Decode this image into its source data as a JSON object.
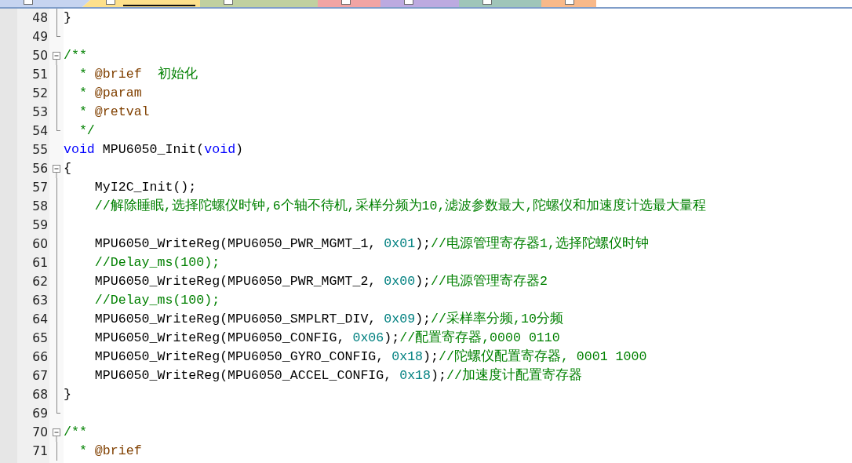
{
  "tabs": [
    {
      "color": "#c6d4f0",
      "selected": false
    },
    {
      "color": "#fde08c",
      "selected": true
    },
    {
      "color": "#c0d0a0",
      "selected": false
    },
    {
      "color": "#f0a4a4",
      "selected": false
    },
    {
      "color": "#bcaae0",
      "selected": false
    },
    {
      "color": "#9fc5b9",
      "selected": false
    },
    {
      "color": "#f8b98a",
      "selected": false
    }
  ],
  "lines": [
    {
      "number": "48",
      "kind": "body",
      "tokens": [
        {
          "kind": "plain",
          "text": "}"
        }
      ]
    },
    {
      "number": "49",
      "kind": "end"
    },
    {
      "number": "50",
      "kind": "start",
      "tokens": [
        {
          "kind": "comment",
          "text": "/**"
        }
      ]
    },
    {
      "number": "51",
      "kind": "body",
      "tokens": [
        {
          "kind": "comment",
          "text": "  * "
        },
        {
          "kind": "doctag",
          "text": "@brief"
        },
        {
          "kind": "comment",
          "text": "  初始化"
        }
      ]
    },
    {
      "number": "52",
      "kind": "body",
      "tokens": [
        {
          "kind": "comment",
          "text": "  * "
        },
        {
          "kind": "doctag",
          "text": "@param"
        }
      ]
    },
    {
      "number": "53",
      "kind": "body",
      "tokens": [
        {
          "kind": "comment",
          "text": "  * "
        },
        {
          "kind": "doctag",
          "text": "@retval"
        }
      ]
    },
    {
      "number": "54",
      "kind": "end",
      "tokens": [
        {
          "kind": "comment",
          "text": "  */"
        }
      ]
    },
    {
      "number": "55",
      "kind": "plain",
      "tokens": [
        {
          "kind": "keyword",
          "text": "void"
        },
        {
          "kind": "plain",
          "text": " MPU6050_Init("
        },
        {
          "kind": "keyword",
          "text": "void"
        },
        {
          "kind": "plain",
          "text": ")"
        }
      ]
    },
    {
      "number": "56",
      "kind": "start",
      "tokens": [
        {
          "kind": "plain",
          "text": "{"
        }
      ]
    },
    {
      "number": "57",
      "kind": "body",
      "tokens": [
        {
          "kind": "plain",
          "text": "    MyI2C_Init();"
        }
      ]
    },
    {
      "number": "58",
      "kind": "body",
      "tokens": [
        {
          "kind": "comment",
          "text": "    //解除睡眠,选择陀螺仪时钟,6个轴不待机,采样分频为10,滤波参数最大,陀螺仪和加速度计选最大量程"
        }
      ]
    },
    {
      "number": "59",
      "kind": "body"
    },
    {
      "number": "60",
      "kind": "body",
      "tokens": [
        {
          "kind": "plain",
          "text": "    MPU6050_WriteReg(MPU6050_PWR_MGMT_1, "
        },
        {
          "kind": "number",
          "text": "0x01"
        },
        {
          "kind": "plain",
          "text": ");"
        },
        {
          "kind": "comment",
          "text": "//电源管理寄存器1,选择陀螺仪时钟"
        }
      ]
    },
    {
      "number": "61",
      "kind": "body",
      "tokens": [
        {
          "kind": "comment",
          "text": "    //Delay_ms(100);"
        }
      ]
    },
    {
      "number": "62",
      "kind": "body",
      "tokens": [
        {
          "kind": "plain",
          "text": "    MPU6050_WriteReg(MPU6050_PWR_MGMT_2, "
        },
        {
          "kind": "number",
          "text": "0x00"
        },
        {
          "kind": "plain",
          "text": ");"
        },
        {
          "kind": "comment",
          "text": "//电源管理寄存器2"
        }
      ]
    },
    {
      "number": "63",
      "kind": "body",
      "tokens": [
        {
          "kind": "comment",
          "text": "    //Delay_ms(100);"
        }
      ]
    },
    {
      "number": "64",
      "kind": "body",
      "tokens": [
        {
          "kind": "plain",
          "text": "    MPU6050_WriteReg(MPU6050_SMPLRT_DIV, "
        },
        {
          "kind": "number",
          "text": "0x09"
        },
        {
          "kind": "plain",
          "text": ");"
        },
        {
          "kind": "comment",
          "text": "//采样率分频,10分频"
        }
      ]
    },
    {
      "number": "65",
      "kind": "body",
      "tokens": [
        {
          "kind": "plain",
          "text": "    MPU6050_WriteReg(MPU6050_CONFIG, "
        },
        {
          "kind": "number",
          "text": "0x06"
        },
        {
          "kind": "plain",
          "text": ");"
        },
        {
          "kind": "comment",
          "text": "//配置寄存器,0000 0110"
        }
      ]
    },
    {
      "number": "66",
      "kind": "body",
      "tokens": [
        {
          "kind": "plain",
          "text": "    MPU6050_WriteReg(MPU6050_GYRO_CONFIG, "
        },
        {
          "kind": "number",
          "text": "0x18"
        },
        {
          "kind": "plain",
          "text": ");"
        },
        {
          "kind": "comment",
          "text": "//陀螺仪配置寄存器, 0001 1000"
        }
      ]
    },
    {
      "number": "67",
      "kind": "body",
      "tokens": [
        {
          "kind": "plain",
          "text": "    MPU6050_WriteReg(MPU6050_ACCEL_CONFIG, "
        },
        {
          "kind": "number",
          "text": "0x18"
        },
        {
          "kind": "plain",
          "text": ");"
        },
        {
          "kind": "comment",
          "text": "//加速度计配置寄存器"
        }
      ]
    },
    {
      "number": "68",
      "kind": "body",
      "tokens": [
        {
          "kind": "plain",
          "text": "}"
        }
      ]
    },
    {
      "number": "69",
      "kind": "end"
    },
    {
      "number": "70",
      "kind": "start",
      "tokens": [
        {
          "kind": "comment",
          "text": "/**"
        }
      ]
    },
    {
      "number": "71",
      "kind": "body",
      "tokens": [
        {
          "kind": "comment",
          "text": "  * "
        },
        {
          "kind": "doctag",
          "text": "@brief"
        }
      ]
    }
  ]
}
